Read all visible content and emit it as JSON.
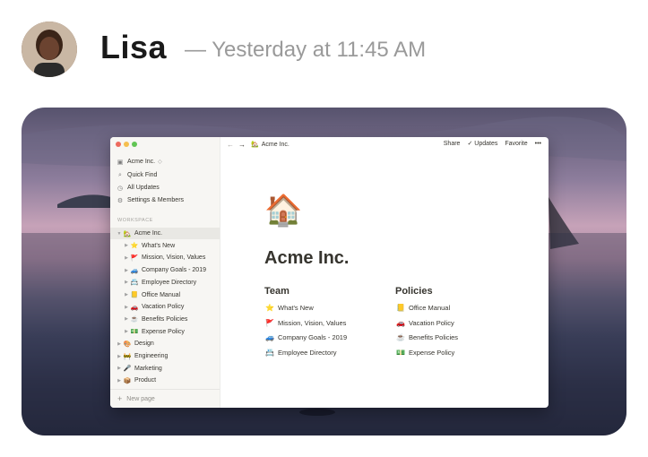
{
  "message": {
    "author": "Lisa",
    "timestamp": "— Yesterday at 11:45 AM"
  },
  "window": {
    "traffic_colors": [
      "#ed6a5e",
      "#f5bf4f",
      "#61c554"
    ],
    "sidebar": {
      "workspace_name": "Acme Inc.",
      "workspace_caret": "◇",
      "menu": [
        {
          "icon": "search-icon",
          "glyph": "⌕",
          "label": "Quick Find"
        },
        {
          "icon": "clock-icon",
          "glyph": "◷",
          "label": "All Updates"
        },
        {
          "icon": "gear-icon",
          "glyph": "⚙",
          "label": "Settings & Members"
        }
      ],
      "section_label": "WORKSPACE",
      "tree": [
        {
          "emoji": "🏡",
          "label": "Acme Inc.",
          "level": 0,
          "open": true
        },
        {
          "emoji": "⭐",
          "label": "What's New",
          "level": 1
        },
        {
          "emoji": "🚩",
          "label": "Mission, Vision, Values",
          "level": 1
        },
        {
          "emoji": "🚙",
          "label": "Company Goals - 2019",
          "level": 1
        },
        {
          "emoji": "📇",
          "label": "Employee Directory",
          "level": 1
        },
        {
          "emoji": "📒",
          "label": "Office Manual",
          "level": 1
        },
        {
          "emoji": "🚗",
          "label": "Vacation Policy",
          "level": 1
        },
        {
          "emoji": "☕",
          "label": "Benefits Policies",
          "level": 1
        },
        {
          "emoji": "💵",
          "label": "Expense Policy",
          "level": 1
        },
        {
          "emoji": "🎨",
          "label": "Design",
          "level": 0
        },
        {
          "emoji": "🚧",
          "label": "Engineering",
          "level": 0
        },
        {
          "emoji": "🎤",
          "label": "Marketing",
          "level": 0
        },
        {
          "emoji": "📦",
          "label": "Product",
          "level": 0
        }
      ],
      "new_page": "New page"
    },
    "topbar": {
      "back": "←",
      "forward": "→",
      "crumb_emoji": "🏡",
      "crumb": "Acme Inc.",
      "share": "Share",
      "updates": "Updates",
      "favorite": "Favorite",
      "more": "•••"
    },
    "page": {
      "emoji": "🏠",
      "title": "Acme Inc.",
      "columns": [
        {
          "heading": "Team",
          "items": [
            {
              "emoji": "⭐",
              "label": "What's New"
            },
            {
              "emoji": "🚩",
              "label": "Mission, Vision, Values"
            },
            {
              "emoji": "🚙",
              "label": "Company Goals - 2019"
            },
            {
              "emoji": "📇",
              "label": "Employee Directory"
            }
          ]
        },
        {
          "heading": "Policies",
          "items": [
            {
              "emoji": "📒",
              "label": "Office Manual"
            },
            {
              "emoji": "🚗",
              "label": "Vacation Policy"
            },
            {
              "emoji": "☕",
              "label": "Benefits Policies"
            },
            {
              "emoji": "💵",
              "label": "Expense Policy"
            }
          ]
        }
      ]
    }
  }
}
